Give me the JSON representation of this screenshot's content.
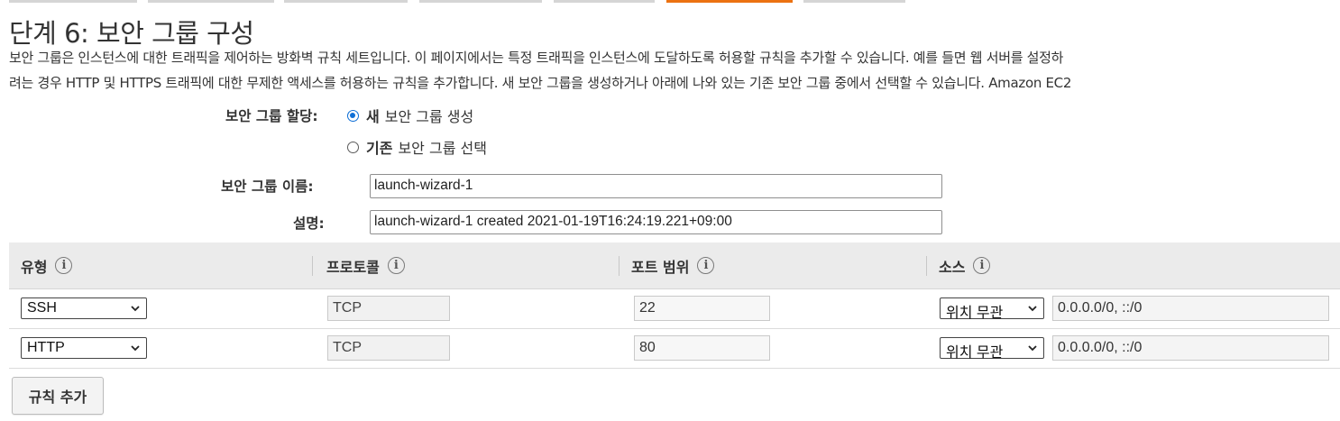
{
  "tabs": [
    {
      "active": false
    },
    {
      "active": false
    },
    {
      "active": false
    },
    {
      "active": false
    },
    {
      "active": false
    },
    {
      "active": true
    },
    {
      "active": false
    }
  ],
  "page": {
    "title": "단계 6: 보안 그룹 구성",
    "description_line1": "보안 그룹은 인스턴스에 대한 트래픽을 제어하는 방화벽 규칙 세트입니다. 이 페이지에서는 특정 트래픽을 인스턴스에 도달하도록 허용할 규칙을 추가할 수 있습니다. 예를 들면 웹 서버를 설정하",
    "description_line2": "려는 경우 HTTP 및 HTTPS 트래픽에 대한 무제한 액세스를 허용하는 규칙을 추가합니다. 새 보안 그룹을 생성하거나 아래에 나와 있는 기존 보안 그룹 중에서 선택할 수 있습니다. Amazon EC2"
  },
  "assignment": {
    "label": "보안 그룹 할당:",
    "option_new_strong": "새",
    "option_new_rest": "보안 그룹 생성",
    "option_new_selected": true,
    "option_existing_strong": "기존",
    "option_existing_rest": "보안 그룹 선택",
    "option_existing_selected": false
  },
  "group_name": {
    "label": "보안 그룹 이름:",
    "value": "launch-wizard-1"
  },
  "description_field": {
    "label": "설명:",
    "value": "launch-wizard-1 created 2021-01-19T16:24:19.221+09:00"
  },
  "table": {
    "headers": {
      "type": "유형",
      "protocol": "프로토콜",
      "port_range": "포트 범위",
      "source": "소스"
    },
    "info_glyph": "i",
    "rows": [
      {
        "type": "SSH",
        "protocol": "TCP",
        "port": "22",
        "source_mode": "위치 무관",
        "cidr": "0.0.0.0/0, ::/0"
      },
      {
        "type": "HTTP",
        "protocol": "TCP",
        "port": "80",
        "source_mode": "위치 무관",
        "cidr": "0.0.0.0/0, ::/0"
      }
    ]
  },
  "add_rule_button": "규칙 추가",
  "colors": {
    "active_tab": "#ec7211",
    "radio_selected": "#0f6fd6",
    "header_bg": "#ebebeb"
  }
}
